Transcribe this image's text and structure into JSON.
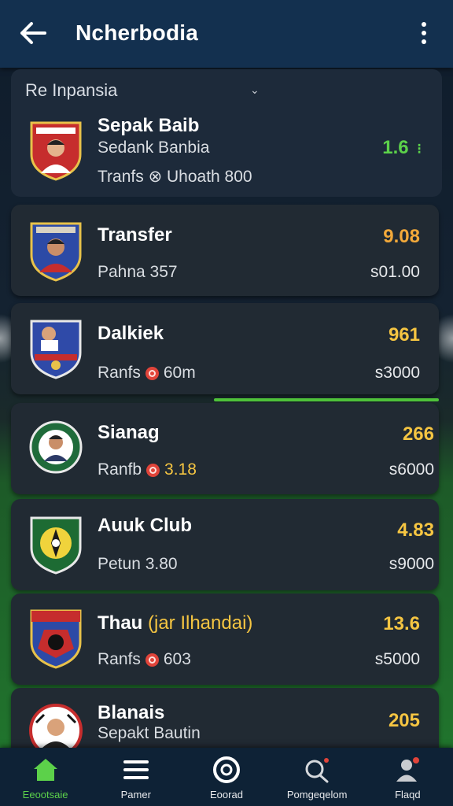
{
  "header": {
    "title": "Ncherbodia",
    "back_icon": "arrow-left-icon",
    "menu_icon": "more-vertical-icon"
  },
  "filter": {
    "selected": "Re Inpansia"
  },
  "featured": {
    "name": "Sepak Baib",
    "subtitle": "Sedank Banbia",
    "meta": "Tranfs ⊗ Uhoath 800",
    "odds": "1.6",
    "odds_color": "#5cd14a"
  },
  "matches": [
    {
      "name": "Transfer",
      "meta_prefix": "Pahna 357",
      "meta_value": "",
      "odds": "9.08",
      "odds_color": "#f3a93a",
      "price": "s01.00"
    },
    {
      "name": "Dalkiek",
      "meta_prefix": "Ranfs",
      "meta_value": "60m",
      "odds": "961",
      "odds_color": "#f5c542",
      "price": "s3000"
    },
    {
      "name": "Sianag",
      "meta_prefix": "Ranfb",
      "meta_value": "3.18",
      "odds": "266",
      "odds_color": "#f5c542",
      "price": "s6000"
    },
    {
      "name": "Auuk Club",
      "meta_prefix": "Petun 3.80",
      "meta_value": "",
      "odds": "4.83",
      "odds_color": "#f5c542",
      "price": "s9000"
    },
    {
      "name_main": "Thau",
      "name_accent": "(jar Ilhandai)",
      "meta_prefix": "Ranfs",
      "meta_value": "603",
      "odds": "13.6",
      "odds_color": "#f5c542",
      "price": "s5000"
    },
    {
      "name": "Blanais",
      "subtitle": "Sepakt Bautin",
      "odds": "205",
      "odds_color": "#f5c542"
    }
  ],
  "progress": {
    "fraction": 0.52
  },
  "colors": {
    "header_bg": "#13304f",
    "card_bg": "#212a33",
    "accent_green": "#5cd14a",
    "accent_orange": "#f3a93a",
    "accent_yellow": "#f5c542"
  },
  "bottom_nav": [
    {
      "label": "Eeootsaie",
      "icon": "home-icon",
      "active": true
    },
    {
      "label": "Pamer",
      "icon": "menu-lines-icon",
      "active": false
    },
    {
      "label": "Eoorad",
      "icon": "ball-icon",
      "active": false
    },
    {
      "label": "Pomgeqelom",
      "icon": "search-icon",
      "active": false
    },
    {
      "label": "Flaqd",
      "icon": "profile-icon",
      "active": false
    }
  ]
}
